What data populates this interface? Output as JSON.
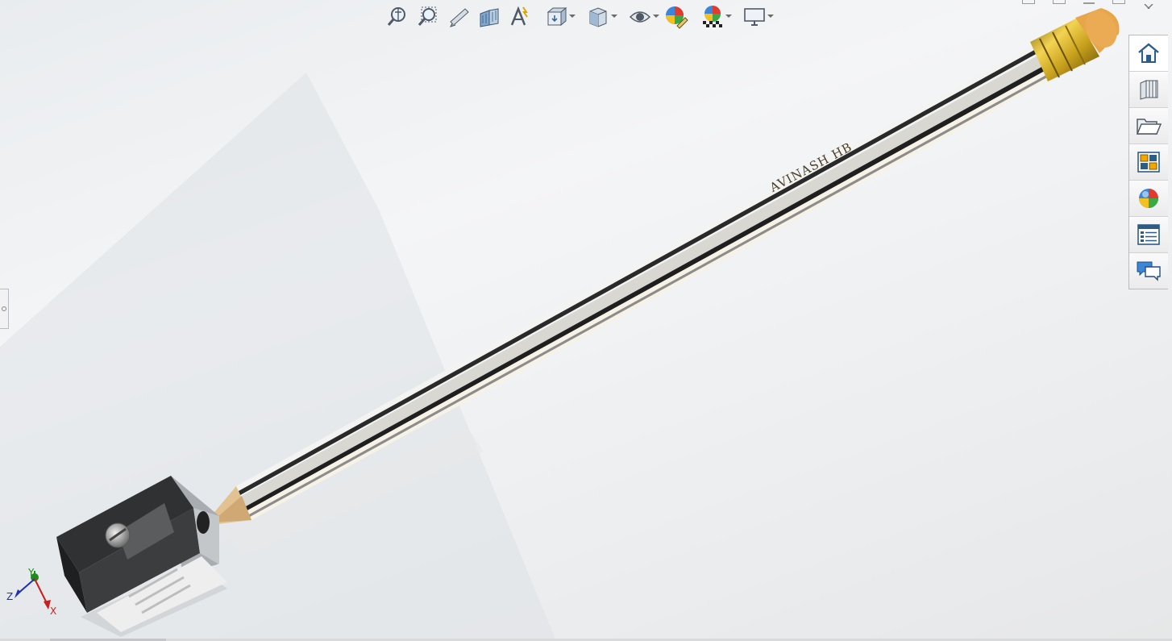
{
  "viewport": {
    "part_engraving": "AVINASH HB",
    "triad": {
      "x_label": "X",
      "y_label": "Y",
      "z_label": "Z"
    },
    "background_top": "#e9ecef",
    "background_bottom": "#e6e7e8"
  },
  "hud_toolbar": {
    "items": [
      {
        "icon": "zoom-to-fit-icon"
      },
      {
        "icon": "zoom-to-area-icon"
      },
      {
        "icon": "previous-view-icon"
      },
      {
        "icon": "section-view-icon"
      },
      {
        "icon": "dynamic-annotation-views-icon"
      },
      {
        "icon": "view-orientation-icon",
        "dropdown": true
      },
      {
        "icon": "display-style-icon",
        "dropdown": true
      },
      {
        "icon": "hide-show-items-icon",
        "dropdown": true
      },
      {
        "icon": "edit-appearance-icon"
      },
      {
        "icon": "apply-scene-icon",
        "dropdown": true
      },
      {
        "icon": "view-settings-icon",
        "dropdown": true
      }
    ]
  },
  "task_pane": {
    "tabs": [
      {
        "icon": "home-icon"
      },
      {
        "icon": "design-library-icon"
      },
      {
        "icon": "file-explorer-icon"
      },
      {
        "icon": "view-palette-icon"
      },
      {
        "icon": "appearances-scenes-icon"
      },
      {
        "icon": "custom-properties-icon"
      },
      {
        "icon": "forum-icon"
      }
    ]
  },
  "colors": {
    "pencil_body": "#e8e6e1",
    "pencil_stripe": "#2a2a2a",
    "ferrule": "#c8a21a",
    "eraser": "#e8a64a",
    "wood": "#e6c79a",
    "sharpener": "#3b3d3f"
  }
}
